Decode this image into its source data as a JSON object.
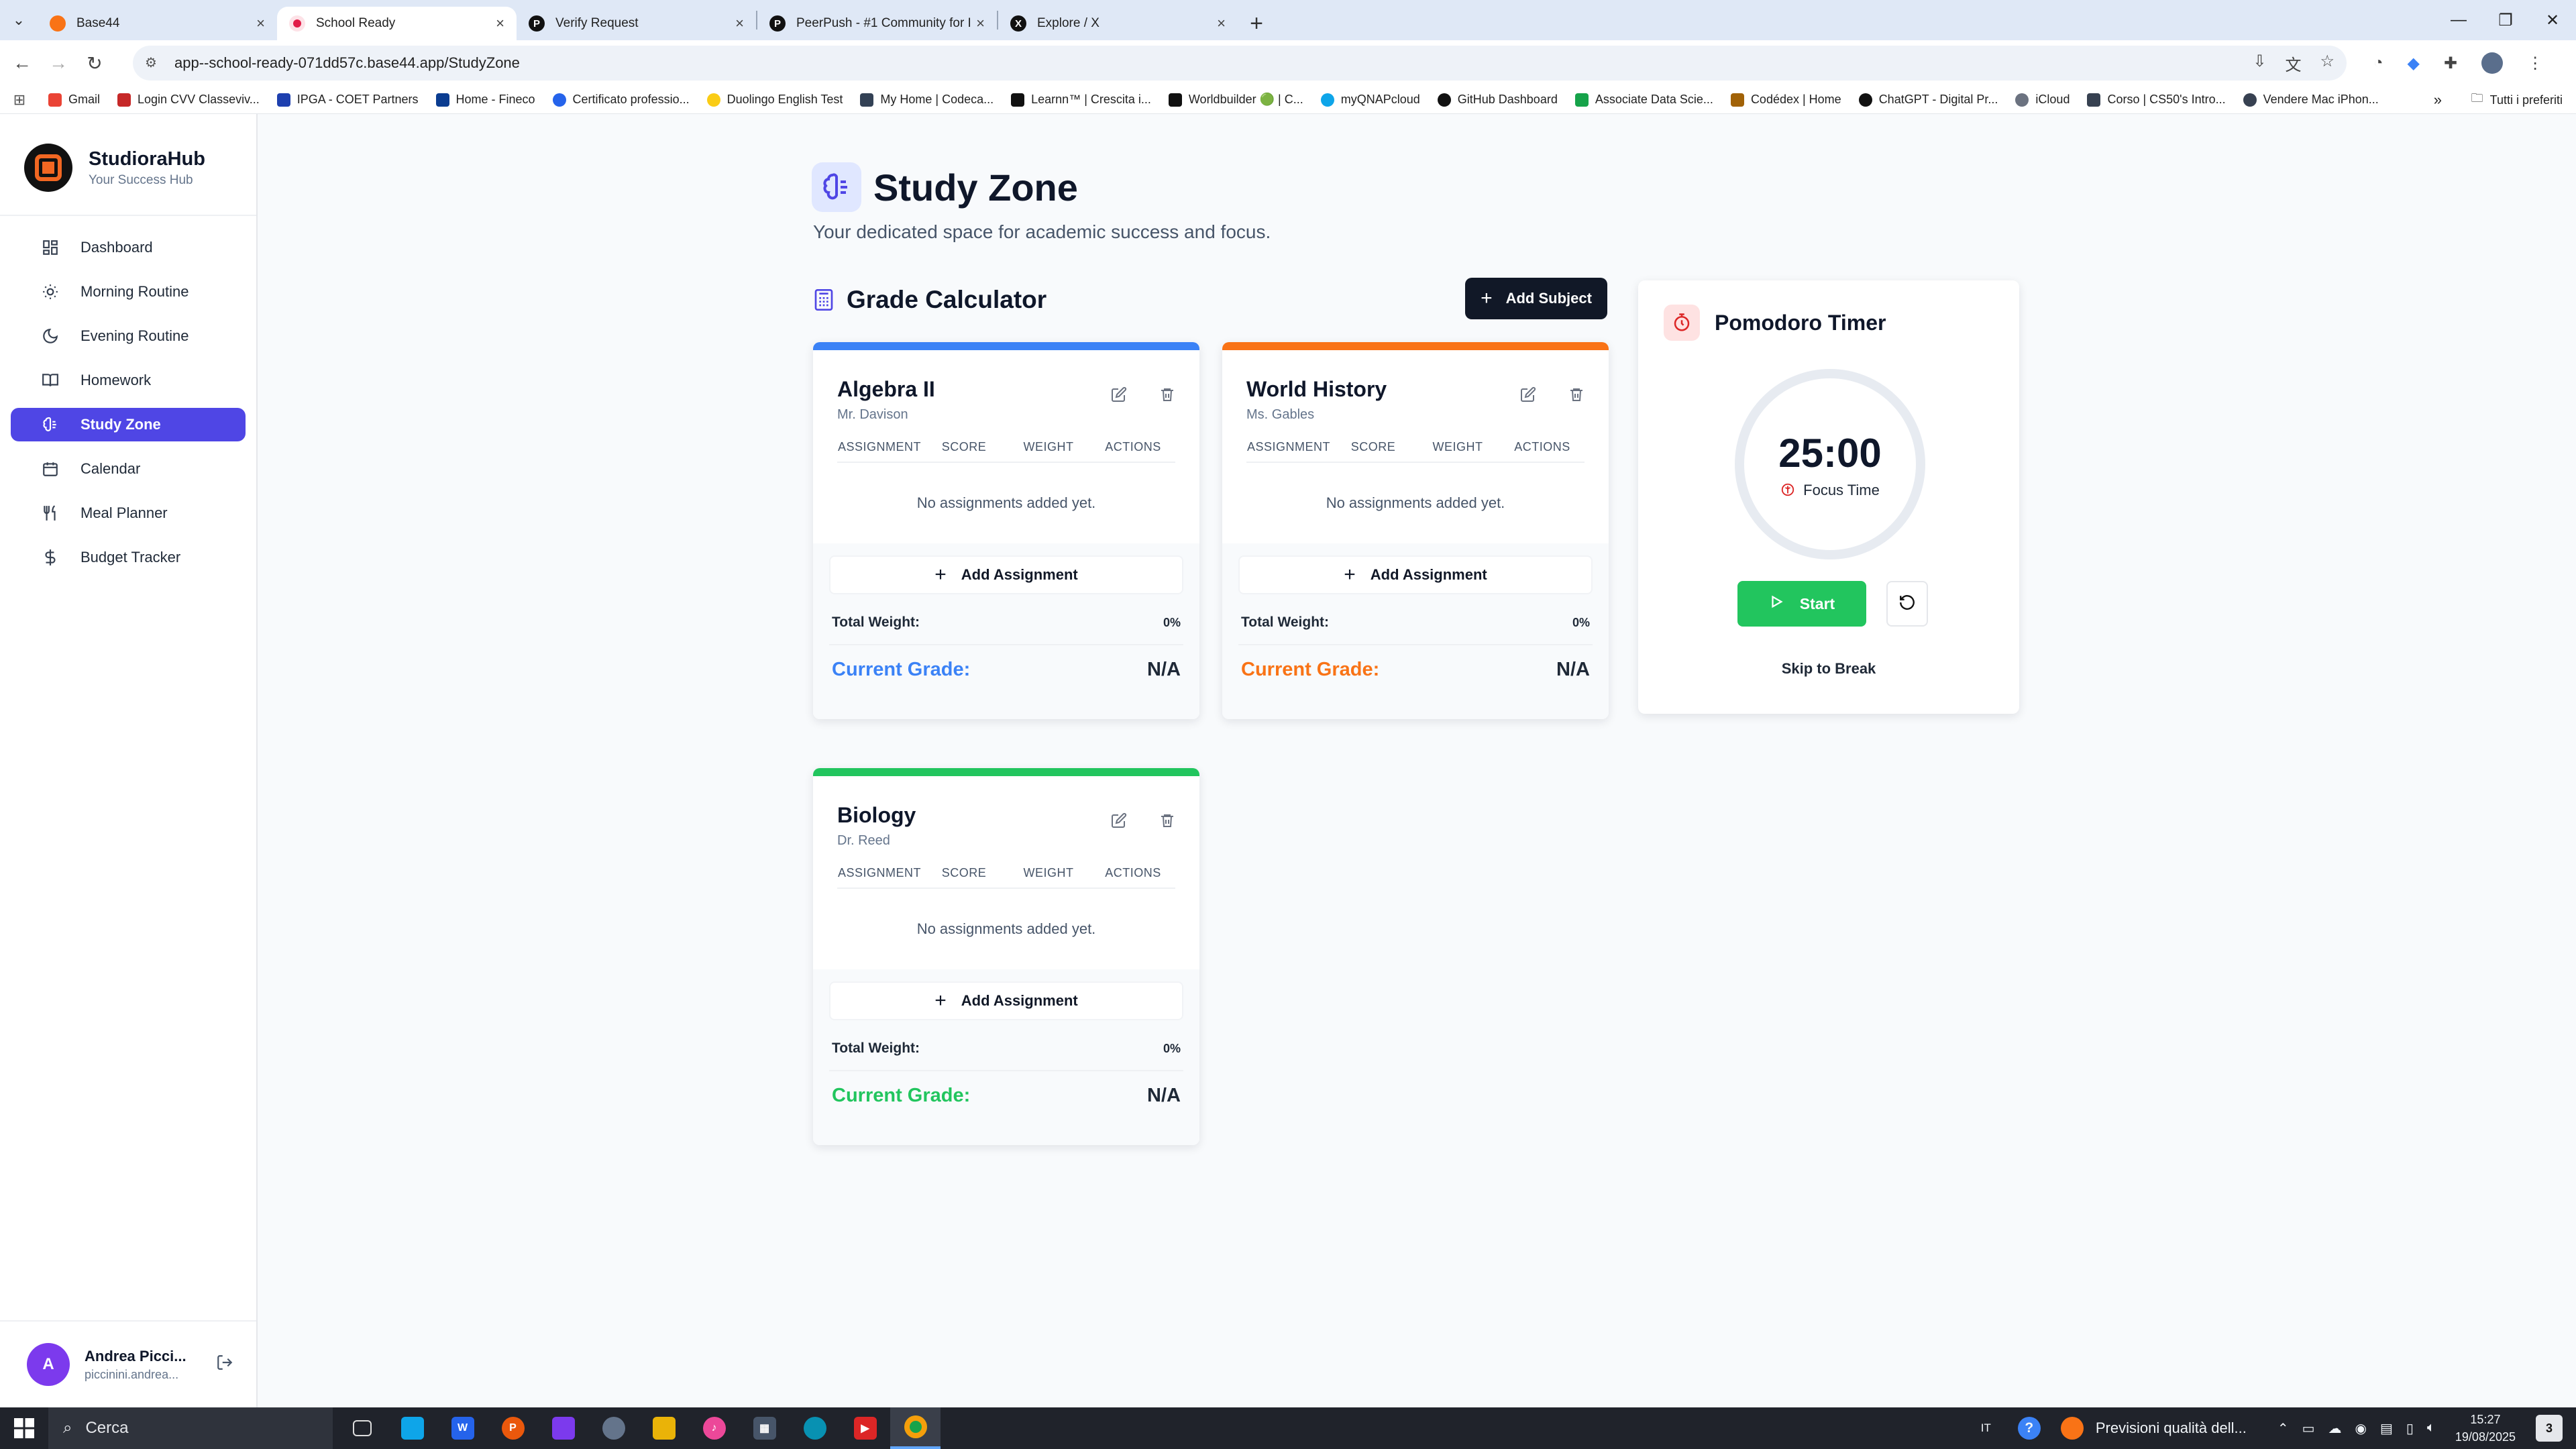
{
  "browser": {
    "tabs": [
      {
        "title": "Base44",
        "fav_color": "#f97316",
        "fav_text": ""
      },
      {
        "title": "School Ready",
        "fav_color": "#e11d48",
        "fav_text": "",
        "active": true
      },
      {
        "title": "Verify Request",
        "fav_color": "#111111",
        "fav_text": "P"
      },
      {
        "title": "PeerPush - #1 Community for I",
        "fav_color": "#111111",
        "fav_text": "P"
      },
      {
        "title": "Explore / X",
        "fav_color": "#111111",
        "fav_text": "X"
      }
    ],
    "url": "app--school-ready-071dd57c.base44.app/StudyZone",
    "bookmarks": [
      {
        "label": "Gmail",
        "color": "#ea4335"
      },
      {
        "label": "Login CVV Classeviv...",
        "color": "#c62828"
      },
      {
        "label": "IPGA - COET Partners",
        "color": "#1e40af"
      },
      {
        "label": "Home - Fineco",
        "color": "#0b3d91"
      },
      {
        "label": "Certificato professio...",
        "color": "#2563eb"
      },
      {
        "label": "Duolingo English Test",
        "color": "#facc15"
      },
      {
        "label": "My Home | Codeca...",
        "color": "#334155"
      },
      {
        "label": "Learnn™ | Crescita i...",
        "color": "#111111"
      },
      {
        "label": "Worldbuilder 🟢 | C...",
        "color": "#111111"
      },
      {
        "label": "myQNAPcloud",
        "color": "#0ea5e9"
      },
      {
        "label": "GitHub Dashboard",
        "color": "#111111"
      },
      {
        "label": "Associate Data Scie...",
        "color": "#16a34a"
      },
      {
        "label": "Codédex | Home",
        "color": "#a16207"
      },
      {
        "label": "ChatGPT - Digital Pr...",
        "color": "#111111"
      },
      {
        "label": "iCloud",
        "color": "#6b7280"
      },
      {
        "label": "Corso | CS50's Intro...",
        "color": "#374151"
      },
      {
        "label": "Vendere Mac iPhon...",
        "color": "#374151"
      }
    ],
    "bookmarks_all": "Tutti i preferiti"
  },
  "sidebar": {
    "brand_name": "StudioraHub",
    "brand_sub": "Your Success Hub",
    "items": [
      {
        "label": "Dashboard",
        "icon": "dashboard-icon"
      },
      {
        "label": "Morning Routine",
        "icon": "sun-icon"
      },
      {
        "label": "Evening Routine",
        "icon": "moon-icon"
      },
      {
        "label": "Homework",
        "icon": "book-icon"
      },
      {
        "label": "Study Zone",
        "icon": "brain-icon",
        "active": true
      },
      {
        "label": "Calendar",
        "icon": "calendar-icon"
      },
      {
        "label": "Meal Planner",
        "icon": "utensils-icon"
      },
      {
        "label": "Budget Tracker",
        "icon": "dollar-icon"
      }
    ],
    "user": {
      "initial": "A",
      "name": "Andrea Picci...",
      "email": "piccinini.andrea..."
    }
  },
  "main": {
    "title": "Study Zone",
    "subtitle": "Your dedicated space for academic success and focus.",
    "grade_calculator": {
      "title": "Grade Calculator",
      "add_subject": "Add Subject",
      "columns": [
        "ASSIGNMENT",
        "SCORE",
        "WEIGHT",
        "ACTIONS"
      ],
      "empty_text": "No assignments added yet.",
      "add_assignment": "Add Assignment",
      "total_weight_label": "Total Weight:",
      "current_grade_label": "Current Grade:",
      "subjects": [
        {
          "name": "Algebra II",
          "teacher": "Mr. Davison",
          "color": "#3b82f6",
          "total_weight": "0%",
          "grade": "N/A"
        },
        {
          "name": "World History",
          "teacher": "Ms. Gables",
          "color": "#f97316",
          "total_weight": "0%",
          "grade": "N/A"
        },
        {
          "name": "Biology",
          "teacher": "Dr. Reed",
          "color": "#22c55e",
          "total_weight": "0%",
          "grade": "N/A"
        }
      ]
    },
    "pomodoro": {
      "title": "Pomodoro Timer",
      "time": "25:00",
      "mode": "Focus Time",
      "start": "Start",
      "skip": "Skip to Break"
    }
  },
  "taskbar": {
    "search_placeholder": "Cerca",
    "lang": "IT",
    "weather": "Previsioni qualità dell...",
    "time": "15:27",
    "date": "19/08/2025",
    "notifications": "3"
  }
}
